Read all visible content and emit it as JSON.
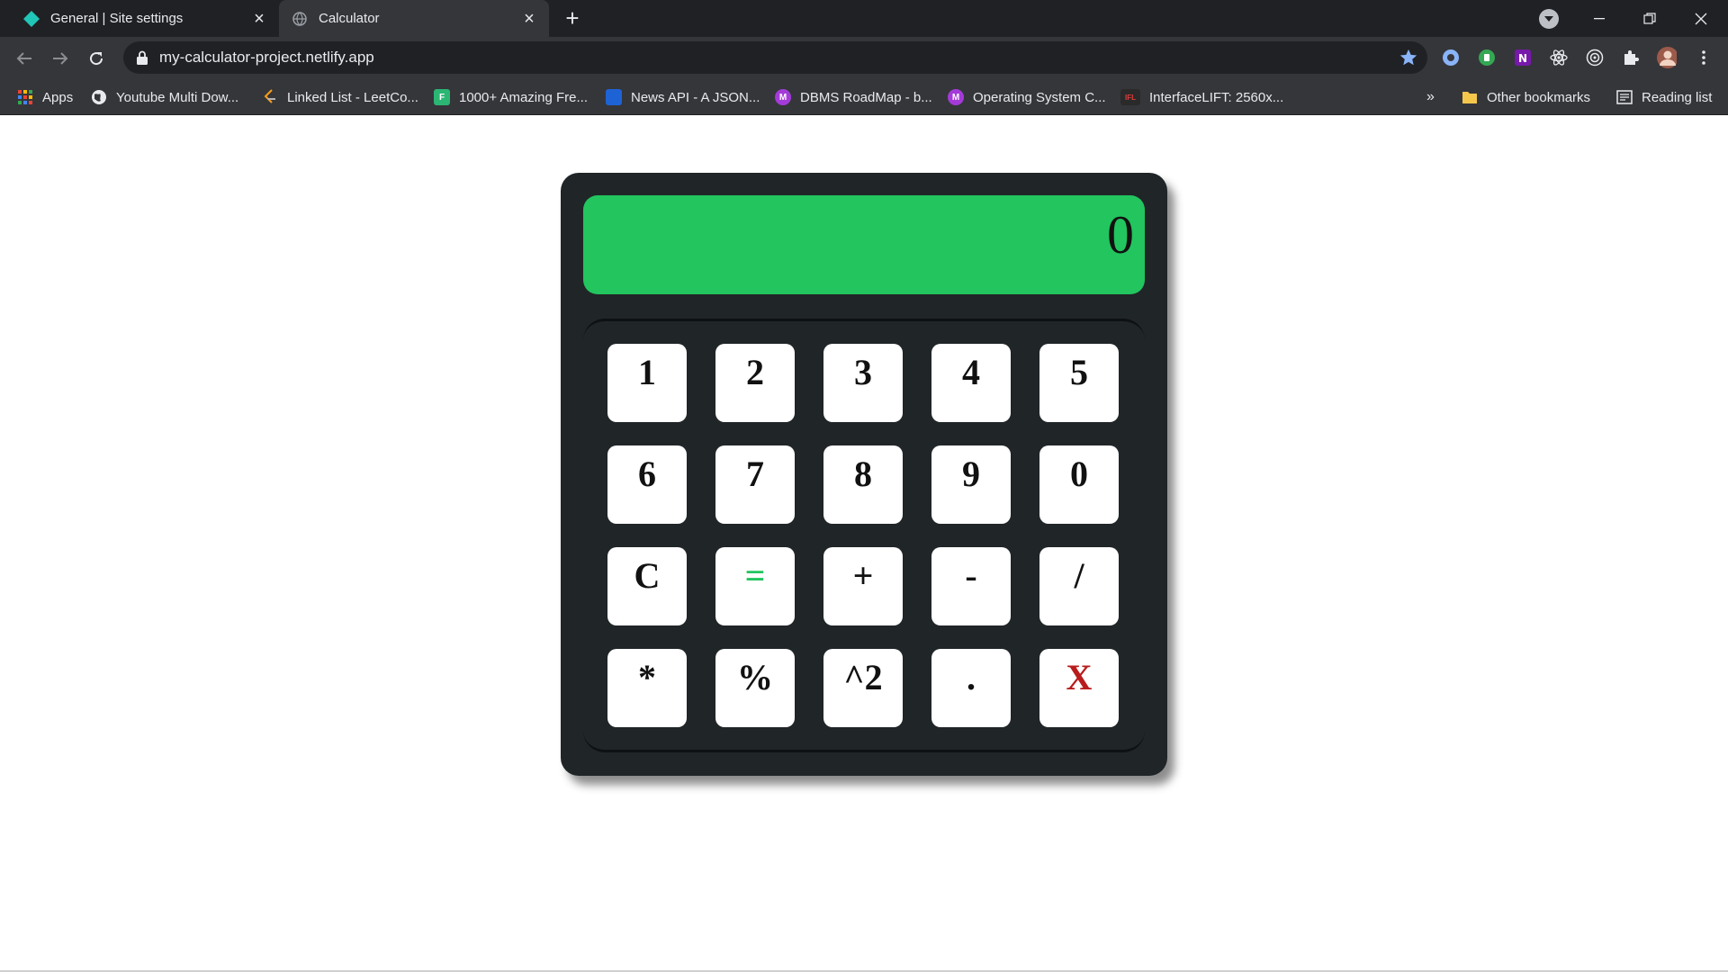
{
  "browser": {
    "tabs": [
      {
        "title": "General | Site settings",
        "active": false,
        "icon": "netlify-diamond-icon"
      },
      {
        "title": "Calculator",
        "active": true,
        "icon": "globe-icon"
      }
    ],
    "address": {
      "url": "my-calculator-project.netlify.app"
    },
    "bookmarks": [
      {
        "label": "Apps",
        "icon": "apps-grid-icon"
      },
      {
        "label": "Youtube Multi Dow...",
        "icon": "globe-icon"
      },
      {
        "label": "Linked List - LeetCo...",
        "icon": "leetcode-icon"
      },
      {
        "label": "1000+ Amazing Fre...",
        "icon": "freepik-icon"
      },
      {
        "label": "News API - A JSON...",
        "icon": "newsapi-icon"
      },
      {
        "label": "DBMS RoadMap - b...",
        "icon": "m-circle-icon"
      },
      {
        "label": "Operating System C...",
        "icon": "m-circle-icon"
      },
      {
        "label": "InterfaceLIFT: 2560x...",
        "icon": "ifl-icon"
      }
    ],
    "overflow": "»",
    "other_bookmarks": "Other bookmarks",
    "reading_list": "Reading list"
  },
  "calculator": {
    "display": "0",
    "keys": [
      [
        "1",
        "2",
        "3",
        "4",
        "5"
      ],
      [
        "6",
        "7",
        "8",
        "9",
        "0"
      ],
      [
        "C",
        "=",
        "+",
        "-",
        "/"
      ],
      [
        "*",
        "%",
        "^2",
        ".",
        "X"
      ]
    ],
    "colors": {
      "body": "#202528",
      "display": "#22c55e",
      "equals_key_text": "#22c55e",
      "exit_key_text": "#b91c1c"
    }
  }
}
